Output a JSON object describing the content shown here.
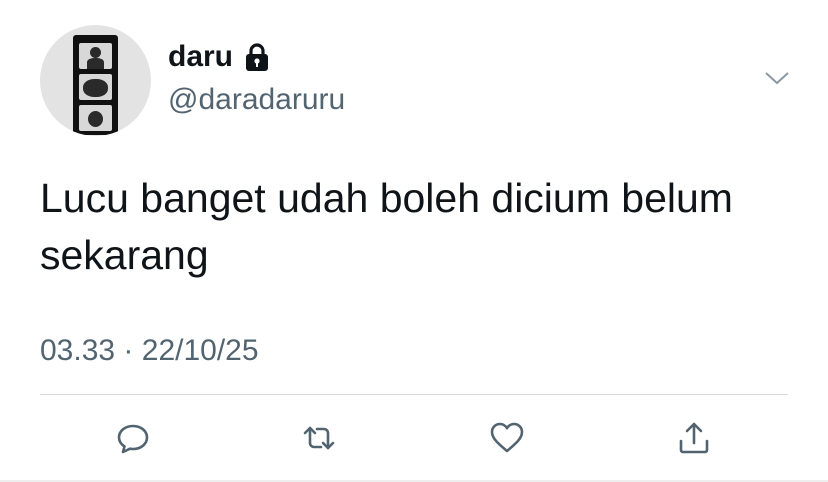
{
  "tweet": {
    "display_name": "daru",
    "handle": "@daradaruru",
    "text": "Lucu banget udah boleh dicium belum sekarang",
    "time": "03.33",
    "separator": "·",
    "date": "22/10/25"
  },
  "icons": {
    "lock": "lock-icon",
    "menu": "chevron-down-icon",
    "reply": "reply-icon",
    "retweet": "retweet-icon",
    "like": "heart-icon",
    "share": "share-icon"
  },
  "colors": {
    "text": "#0f1419",
    "secondary": "#536471",
    "divider": "#d9d9d9"
  }
}
